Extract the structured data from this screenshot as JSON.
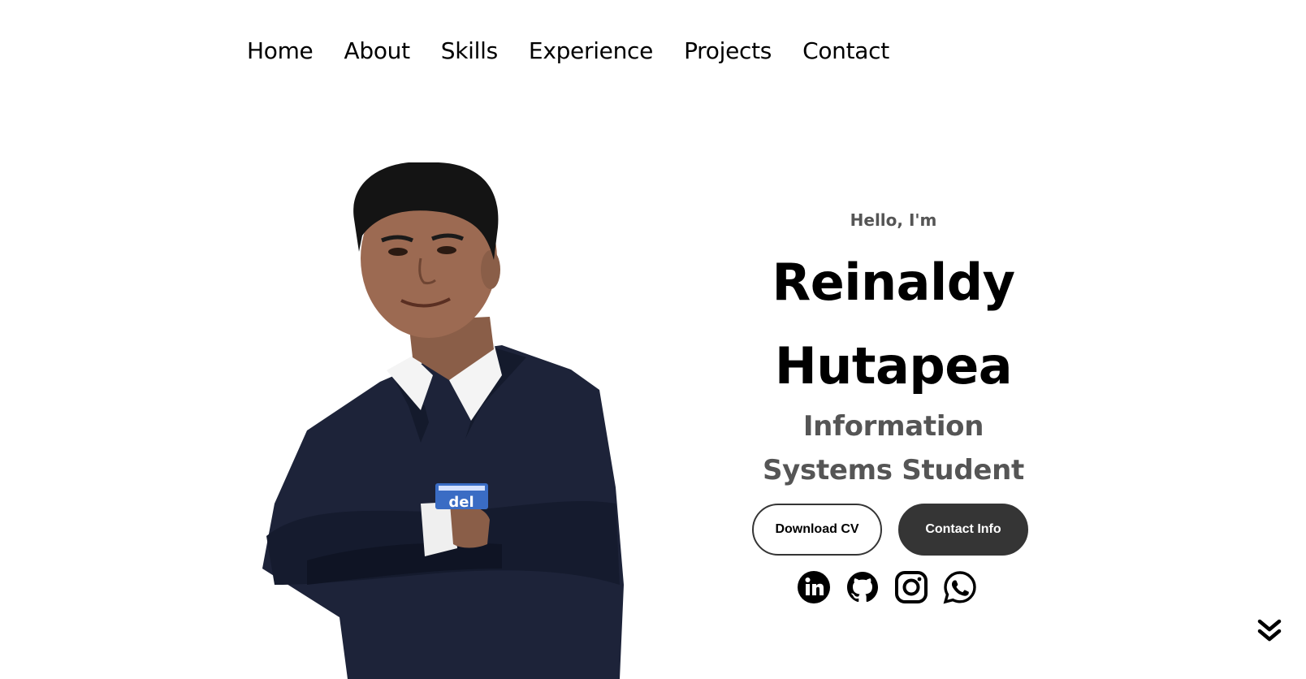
{
  "nav": {
    "items": [
      {
        "label": "Home",
        "name": "nav-home"
      },
      {
        "label": "About",
        "name": "nav-about"
      },
      {
        "label": "Skills",
        "name": "nav-skills"
      },
      {
        "label": "Experience",
        "name": "nav-experience"
      },
      {
        "label": "Projects",
        "name": "nav-projects"
      },
      {
        "label": "Contact",
        "name": "nav-contact"
      }
    ]
  },
  "hero": {
    "greeting": "Hello, I'm",
    "name_line1": "Reinaldy",
    "name_line2": "Hutapea",
    "role_line1": "Information",
    "role_line2": "Systems Student",
    "download_cv_label": "Download CV",
    "contact_info_label": "Contact Info"
  },
  "social": [
    {
      "icon": "linkedin-icon"
    },
    {
      "icon": "github-icon"
    },
    {
      "icon": "instagram-icon"
    },
    {
      "icon": "whatsapp-icon"
    }
  ],
  "colors": {
    "text_primary": "#000000",
    "text_secondary": "#555555",
    "button_dark": "#353535",
    "background": "#ffffff"
  },
  "icons": {
    "scroll": "double-chevron-down-icon"
  }
}
